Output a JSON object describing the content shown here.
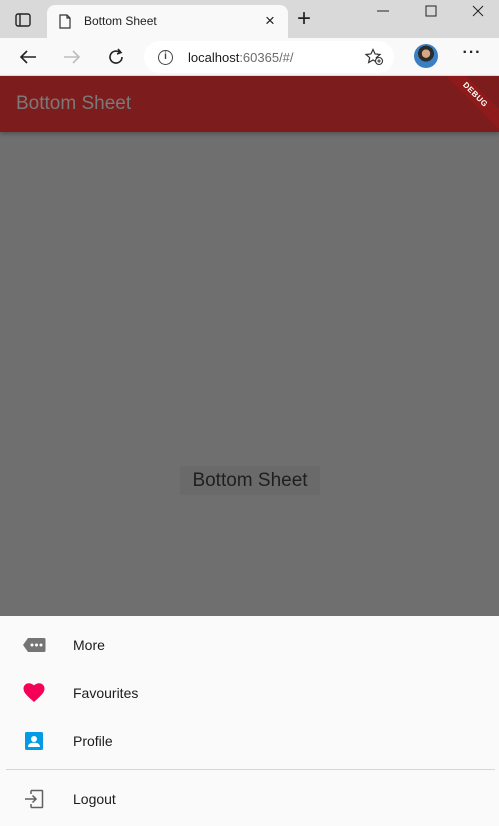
{
  "browser": {
    "tab_title": "Bottom Sheet",
    "tab_close_glyph": "×",
    "new_tab_glyph": "+",
    "url_host": "localhost",
    "url_rest": ":60365/#/",
    "info_glyph": "i",
    "more_glyph": "···"
  },
  "app": {
    "title": "Bottom Sheet",
    "debug_label": "DEBUG",
    "body_button_label": "Bottom Sheet",
    "colors": {
      "appbar": "#7d1c1c",
      "scrim": "#6f6f6f",
      "sheet": "#fafafa",
      "heart": "#f50057",
      "profile": "#039be5"
    }
  },
  "sheet": {
    "items": [
      {
        "label": "More",
        "icon": "label-more-icon"
      },
      {
        "label": "Favourites",
        "icon": "heart-icon"
      },
      {
        "label": "Profile",
        "icon": "account-box-icon"
      }
    ],
    "logout": {
      "label": "Logout",
      "icon": "logout-icon"
    }
  }
}
